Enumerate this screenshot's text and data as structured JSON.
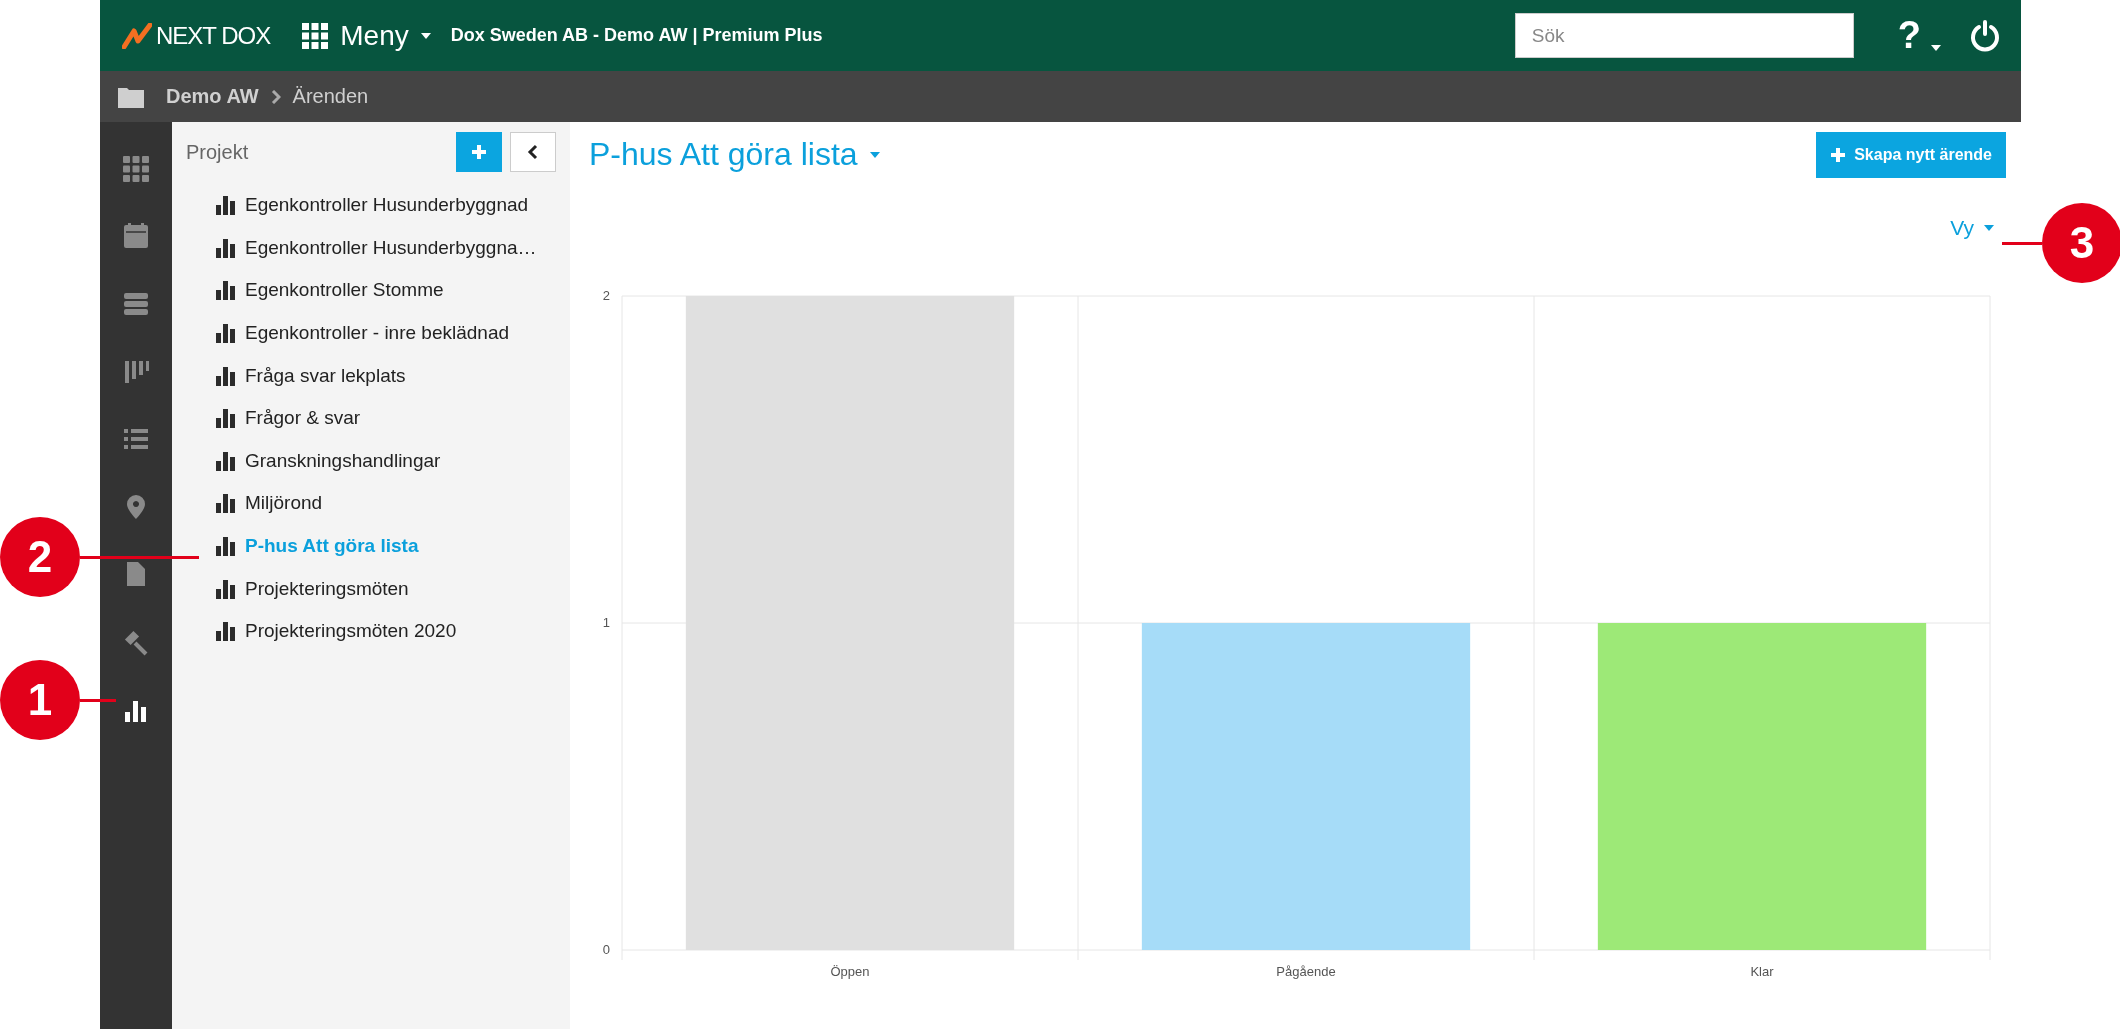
{
  "topbar": {
    "logo": "NEXT DOX",
    "menu": "Meny",
    "account": "Dox Sweden AB - Demo AW | Premium Plus",
    "search": {
      "placeholder": "Sök"
    },
    "help": "?"
  },
  "breadcrumb": [
    "Demo AW",
    "Ärenden"
  ],
  "rail": [
    {
      "kind": "grid",
      "selected": false
    },
    {
      "kind": "calendar",
      "selected": false
    },
    {
      "kind": "server",
      "selected": false
    },
    {
      "kind": "kanban",
      "selected": false
    },
    {
      "kind": "list",
      "selected": false
    },
    {
      "kind": "pin",
      "selected": false
    },
    {
      "kind": "file",
      "selected": false
    },
    {
      "kind": "gavel",
      "selected": false
    },
    {
      "kind": "chart",
      "selected": true
    }
  ],
  "projects": {
    "title": "Projekt",
    "items": [
      {
        "label": "Egenkontroller Husunderbyggnad",
        "selected": false
      },
      {
        "label": "Egenkontroller Husunderbyggna…",
        "selected": false
      },
      {
        "label": "Egenkontroller Stomme",
        "selected": false
      },
      {
        "label": "Egenkontroller - inre beklädnad",
        "selected": false
      },
      {
        "label": "Fråga svar lekplats",
        "selected": false
      },
      {
        "label": "Frågor & svar",
        "selected": false
      },
      {
        "label": "Granskningshandlingar",
        "selected": false
      },
      {
        "label": "Miljörond",
        "selected": false
      },
      {
        "label": "P-hus Att göra lista",
        "selected": true
      },
      {
        "label": "Projekteringsmöten",
        "selected": false
      },
      {
        "label": "Projekteringsmöten 2020",
        "selected": false
      }
    ]
  },
  "main": {
    "title": "P-hus Att göra lista",
    "create_button": "Skapa nytt ärende",
    "view_menu": "Vy",
    "chart_data": {
      "type": "bar",
      "categories": [
        "Öppen",
        "Pågående",
        "Klar"
      ],
      "values": [
        2,
        1,
        1
      ],
      "colors": [
        "#e0e0e0",
        "#a6dcf8",
        "#9de977"
      ],
      "ylim": [
        0,
        2
      ],
      "yticks": [
        0,
        1,
        2
      ]
    }
  },
  "callouts": [
    {
      "number": "1",
      "kind": "rail"
    },
    {
      "number": "2",
      "kind": "project"
    },
    {
      "number": "3",
      "kind": "view"
    }
  ]
}
